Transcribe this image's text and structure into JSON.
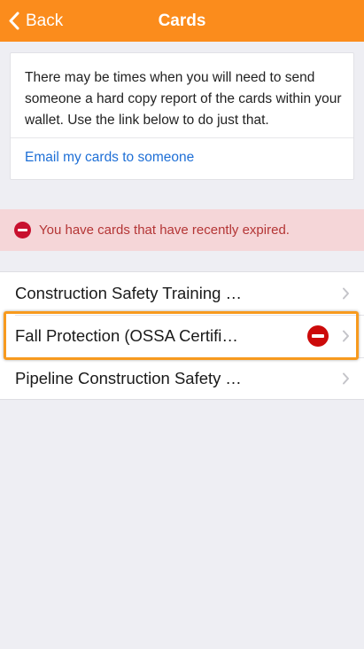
{
  "header": {
    "back_label": "Back",
    "title": "Cards"
  },
  "info_card": {
    "text": "There may be times when you will need to send someone a hard copy report of the cards within your wallet. Use the link below to do just that.",
    "link_label": "Email my cards to someone"
  },
  "alert": {
    "text": "You have cards that have recently expired."
  },
  "cards": [
    {
      "label": "Construction Safety Training System (CSTS)",
      "expired": false
    },
    {
      "label": "Fall Protection (OSSA Certified)",
      "expired": true
    },
    {
      "label": "Pipeline Construction Safety Training (PCST)",
      "expired": false
    }
  ],
  "colors": {
    "nav_bar": "#fb8c1c",
    "link": "#1e6fd6",
    "alert_bg": "#f5d6d8",
    "alert_text": "#b43535",
    "expired_icon": "#cc0a0a",
    "highlight": "#f79a1e"
  }
}
